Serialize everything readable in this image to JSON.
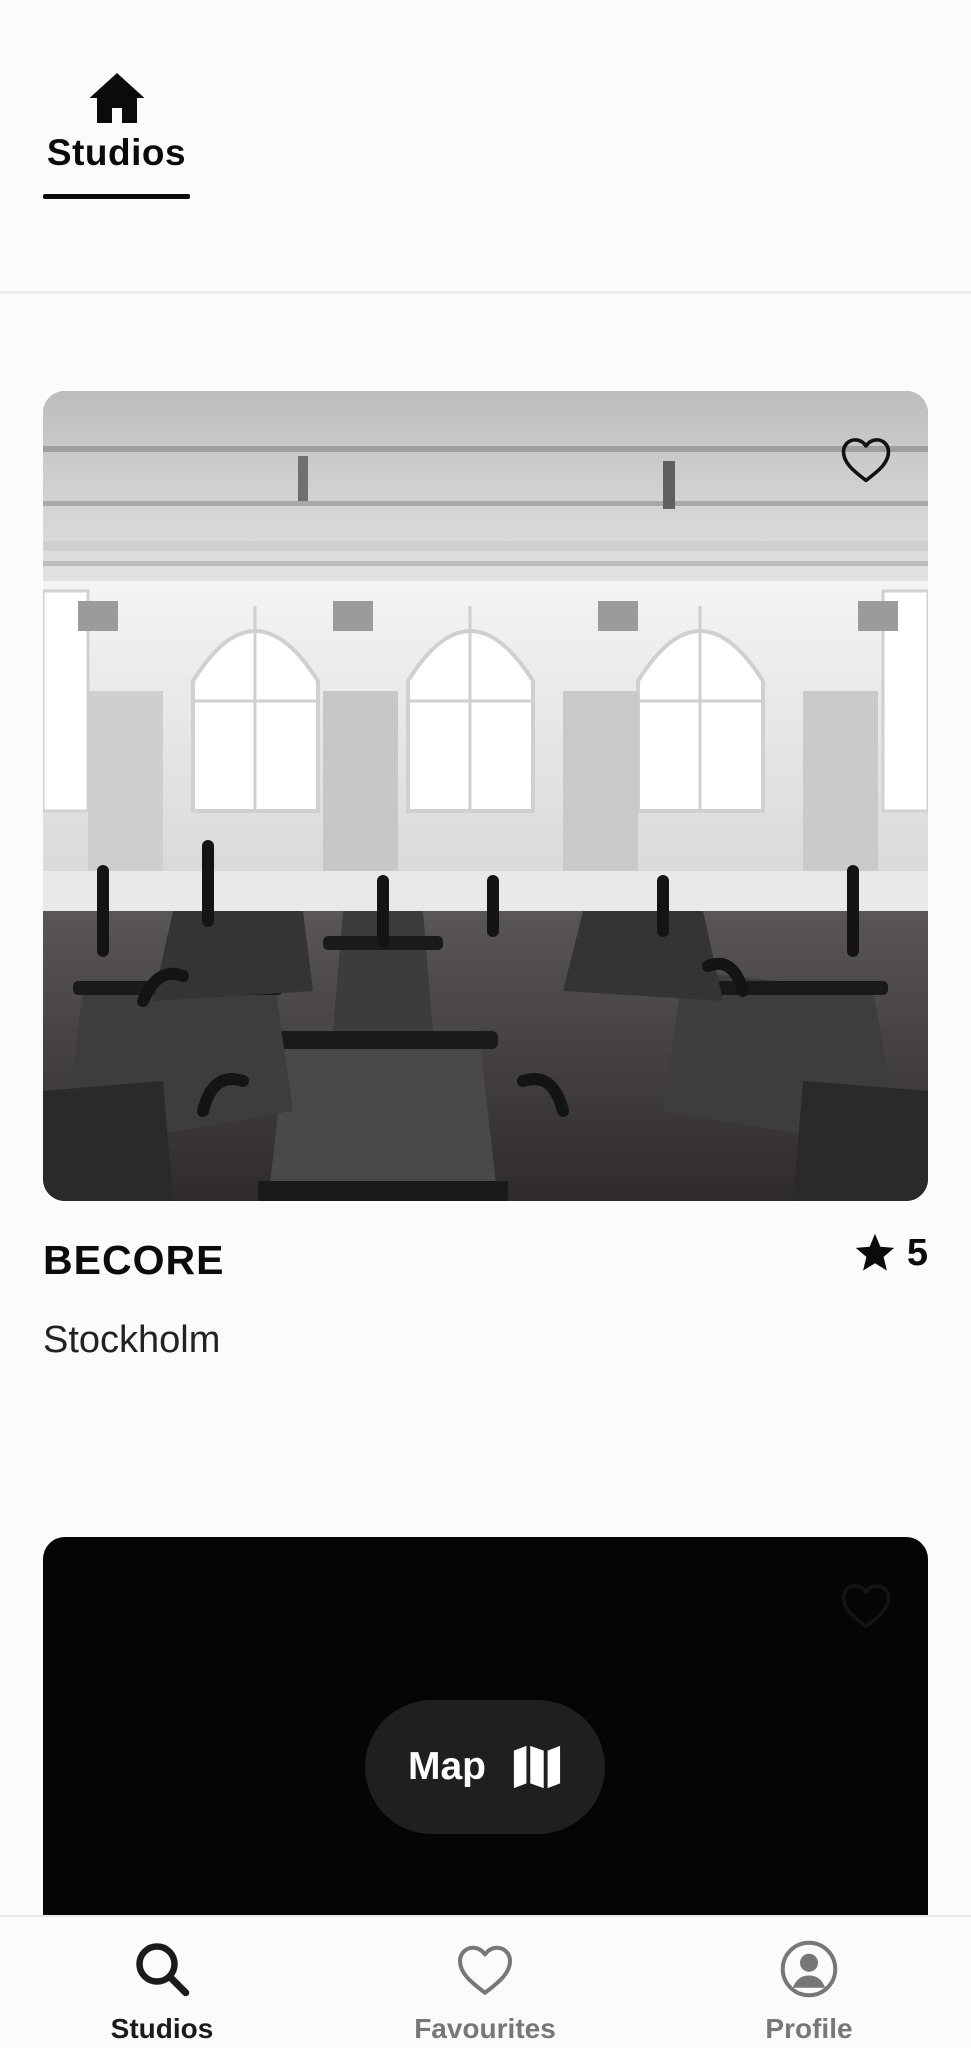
{
  "top_tabs": {
    "items": [
      {
        "label": "Studios",
        "icon": "home-icon",
        "active": true
      }
    ]
  },
  "studios": [
    {
      "name": "BECORE",
      "city": "Stockholm",
      "rating": "5",
      "favourite": false
    },
    {
      "name": "",
      "city": "",
      "rating": "",
      "favourite": false
    }
  ],
  "map_button": {
    "label": "Map",
    "icon": "map-icon"
  },
  "bottom_nav": {
    "items": [
      {
        "label": "Studios",
        "icon": "search-icon",
        "active": true
      },
      {
        "label": "Favourites",
        "icon": "heart-icon",
        "active": false
      },
      {
        "label": "Profile",
        "icon": "profile-icon",
        "active": false
      }
    ]
  },
  "colors": {
    "text_primary": "#0b0b0b",
    "nav_inactive": "#777777",
    "map_button_bg": "#1f1f1f",
    "background": "#fbfbfb"
  }
}
